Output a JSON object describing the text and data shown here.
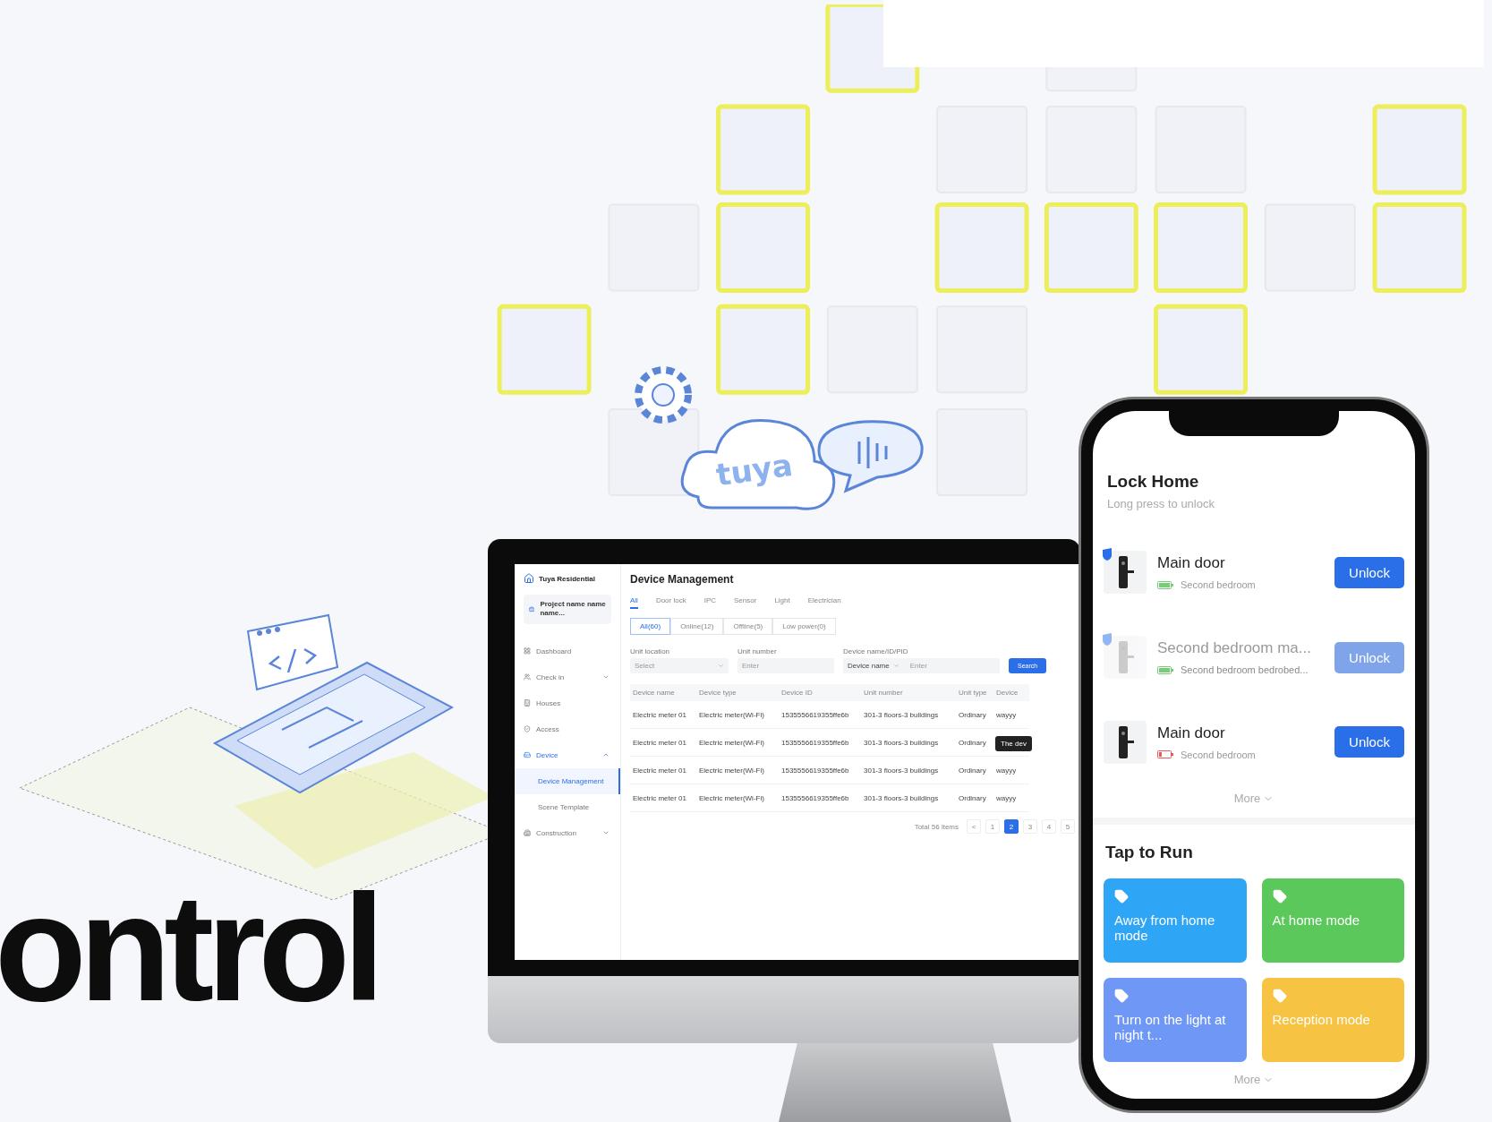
{
  "headline": "ontrol",
  "cloud": {
    "logo": "tuya"
  },
  "monitor": {
    "brand": "Tuya Residential",
    "project": "Project name name name...",
    "nav": [
      {
        "label": "Dashboard",
        "kind": "link",
        "selected": false
      },
      {
        "label": "Check in",
        "kind": "group",
        "expanded": false,
        "selected": false
      },
      {
        "label": "Houses",
        "kind": "link",
        "selected": false
      },
      {
        "label": "Access",
        "kind": "link",
        "selected": false
      },
      {
        "label": "Device",
        "kind": "group",
        "expanded": true,
        "selected": true,
        "children": [
          {
            "label": "Device Management",
            "selected": true
          },
          {
            "label": "Scene Template",
            "selected": false
          }
        ]
      },
      {
        "label": "Construction",
        "kind": "group",
        "expanded": false,
        "selected": false
      }
    ],
    "title": "Device Management",
    "tabs": [
      {
        "label": "All",
        "selected": true
      },
      {
        "label": "Door lock",
        "selected": false
      },
      {
        "label": "IPC",
        "selected": false
      },
      {
        "label": "Sensor",
        "selected": false
      },
      {
        "label": "Light",
        "selected": false
      },
      {
        "label": "Electrician",
        "selected": false
      }
    ],
    "status_filters": [
      {
        "label": "All(60)",
        "selected": true
      },
      {
        "label": "Online(12)",
        "selected": false
      },
      {
        "label": "Offline(5)",
        "selected": false
      },
      {
        "label": "Low power(0)",
        "selected": false
      }
    ],
    "filters": [
      {
        "label": "Unit location",
        "kind": "select",
        "placeholder": "Select"
      },
      {
        "label": "Unit number",
        "kind": "input",
        "placeholder": "Enter"
      },
      {
        "label": "Device name/ID/PID",
        "kind": "combo",
        "option": "Device name",
        "placeholder": "Enter"
      }
    ],
    "search_button": "Search",
    "table": {
      "columns": [
        "Device name",
        "Device type",
        "Device ID",
        "Unit number",
        "Unit type",
        "Device"
      ],
      "rows": [
        [
          "Electric meter 01",
          "Electric meter(Wi-Fi)",
          "1535556619355ffe6b",
          "301-3 floors-3 buildings",
          "Ordinary",
          "wayyy"
        ],
        [
          "Electric meter 01",
          "Electric meter(Wi-Fi)",
          "1535556619355ffe6b",
          "301-3 floors-3 buildings",
          "Ordinary"
        ],
        [
          "Electric meter 01",
          "Electric meter(Wi-Fi)",
          "1535556619355ffe6b",
          "301-3 floors-3 buildings",
          "Ordinary",
          "wayyy"
        ],
        [
          "Electric meter 01",
          "Electric meter(Wi-Fi)",
          "1535556619355ffe6b",
          "301-3 floors-3 buildings",
          "Ordinary",
          "wayyy"
        ]
      ]
    },
    "tooltip": "The dev",
    "pagination": {
      "total": "Total 56 items",
      "prev": "<",
      "pages": [
        {
          "label": "1",
          "selected": false
        },
        {
          "label": "2",
          "selected": true
        },
        {
          "label": "3",
          "selected": false
        },
        {
          "label": "4",
          "selected": false
        },
        {
          "label": "5",
          "selected": false
        }
      ]
    }
  },
  "phone": {
    "title": "Lock Home",
    "subtitle": "Long press to unlock",
    "locks": [
      {
        "name": "Main door",
        "room": "Second bedroom",
        "badge": true,
        "battery_low": false,
        "disabled": false,
        "button": "Unlock"
      },
      {
        "name": "Second bedroom ma...",
        "room": "Second bedroom bedrobed...",
        "badge": true,
        "battery_low": false,
        "disabled": true,
        "button": "Unlock"
      },
      {
        "name": "Main door",
        "room": "Second bedroom",
        "badge": false,
        "battery_low": true,
        "disabled": false,
        "button": "Unlock"
      }
    ],
    "locks_more": "More",
    "scenes_title": "Tap to Run",
    "scenes": [
      {
        "label": "Away from home mode",
        "color": "#2ea6f5"
      },
      {
        "label": "At home mode",
        "color": "#5bc85b"
      },
      {
        "label": "Turn on the light at night t...",
        "color": "#6f97f5"
      },
      {
        "label": "Reception mode",
        "color": "#f6c343"
      }
    ],
    "scenes_more": "More"
  }
}
